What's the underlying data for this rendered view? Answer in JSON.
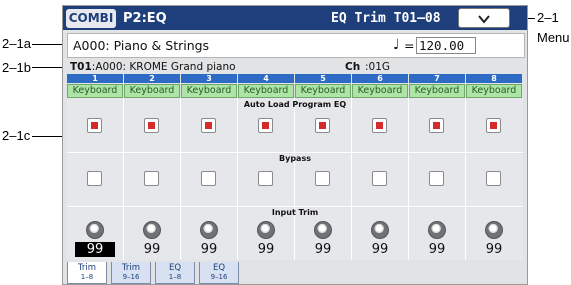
{
  "callouts": {
    "menu_number": "2–1",
    "menu_word": "Menu",
    "program_row": "2–1a",
    "timbre_row": "2–1b",
    "grid": "2–1c"
  },
  "header": {
    "mode": "COMBI",
    "page": "P2:EQ",
    "title": "EQ Trim T01–08",
    "menu_icon": "chevron-down-icon"
  },
  "program": {
    "name": "A000: Piano & Strings",
    "tempo_symbol": "♩",
    "tempo_equals": "=",
    "tempo_value": "120.00"
  },
  "timbre": {
    "label": "T01",
    "program": ":A000: KROME Grand piano",
    "ch_label": "Ch",
    "ch_value": ":01G"
  },
  "columns": [
    "1",
    "2",
    "3",
    "4",
    "5",
    "6",
    "7",
    "8"
  ],
  "keyboard_label": "Keyboard",
  "sections": {
    "auto_load": "Auto Load Program EQ",
    "bypass": "Bypass",
    "input_trim": "Input Trim"
  },
  "auto_load_checked": [
    true,
    true,
    true,
    true,
    true,
    true,
    true,
    true
  ],
  "bypass_checked": [
    false,
    false,
    false,
    false,
    false,
    false,
    false,
    false
  ],
  "trim_values": [
    "99",
    "99",
    "99",
    "99",
    "99",
    "99",
    "99",
    "99"
  ],
  "selected_trim_index": 0,
  "tabs": [
    {
      "line1": "Trim",
      "line2": "1–8",
      "active": true
    },
    {
      "line1": "Trim",
      "line2": "9–16",
      "active": false
    },
    {
      "line1": "EQ",
      "line2": "1–8",
      "active": false
    },
    {
      "line1": "EQ",
      "line2": "9–16",
      "active": false
    }
  ],
  "colors": {
    "header": "#1e3f7c",
    "column_head": "#2d6bc4",
    "keyboard_cell": "#ace5a6",
    "check_red": "#d52b2b"
  }
}
